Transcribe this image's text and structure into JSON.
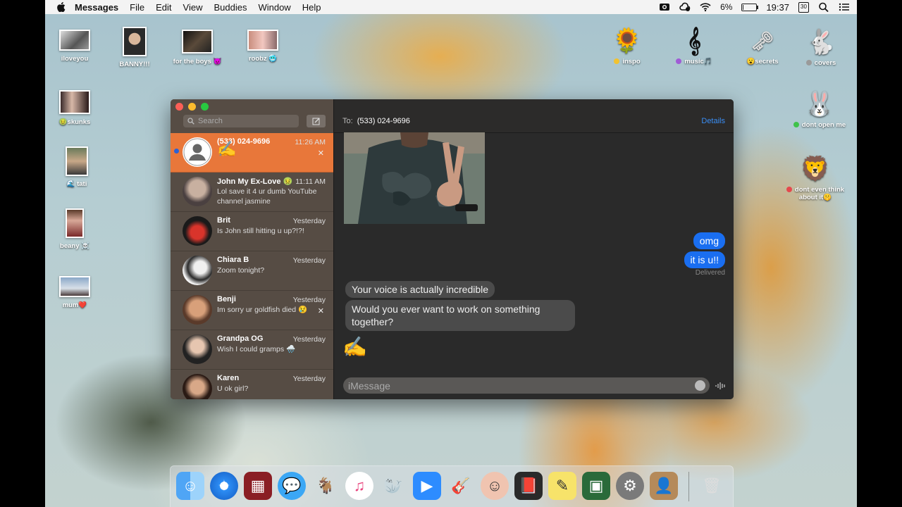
{
  "menubar": {
    "app_name": "Messages",
    "menus": [
      "File",
      "Edit",
      "View",
      "Buddies",
      "Window",
      "Help"
    ],
    "battery": "6%",
    "battery_level": 0.06,
    "clock": "19:37",
    "notif_count": "30"
  },
  "desktop": {
    "left_icons": [
      {
        "label": "iloveyou"
      },
      {
        "label": "BANNY!!!"
      },
      {
        "label": "for the boys 😈"
      },
      {
        "label": "roobz 🥶"
      },
      {
        "label": "skunks",
        "emoji": "🤢"
      },
      {
        "label": "tati",
        "emoji": "🌊"
      },
      {
        "label": "beany ☠️"
      },
      {
        "label": "mum❤️"
      }
    ],
    "right_icons": [
      {
        "label": "inspo",
        "dot_color": "#f2c230"
      },
      {
        "label": "music🎵",
        "dot_color": "#a05cd6"
      },
      {
        "label": "secrets",
        "emoji": "😮"
      },
      {
        "label": "covers",
        "dot_color": "#9a9a9a"
      },
      {
        "label": "dont open me",
        "dot_color": "#3fc24a"
      },
      {
        "label": "dont even think about it🤫",
        "dot_color": "#e5484d"
      }
    ]
  },
  "sidebar": {
    "search_placeholder": "Search",
    "conversations": [
      {
        "name": "(533) 024-9696",
        "time": "11:26 AM",
        "preview": "✍️",
        "active": true
      },
      {
        "name": "John My Ex-Love 🤢 ...",
        "time": "11:11 AM",
        "preview": "Lol save it 4 ur dumb YouTube channel jasmine"
      },
      {
        "name": "Brit",
        "time": "Yesterday",
        "preview": "Is John still hitting u up?!?!"
      },
      {
        "name": "Chiara B",
        "time": "Yesterday",
        "preview": "Zoom tonight?"
      },
      {
        "name": "Benji",
        "time": "Yesterday",
        "preview": "Im sorry ur goldfish died 😢"
      },
      {
        "name": "Grandpa OG",
        "time": "Yesterday",
        "preview": "Wish I could gramps 🌧️"
      },
      {
        "name": "Karen",
        "time": "Yesterday",
        "preview": "U ok girl?"
      }
    ]
  },
  "chat": {
    "to_label": "To:",
    "recipient": "(533) 024-9696",
    "details": "Details",
    "messages": [
      {
        "text": "omg",
        "from": "me"
      },
      {
        "text": "it is u!!",
        "from": "me"
      },
      {
        "text": "Your voice is actually incredible",
        "from": "them"
      },
      {
        "text": "Would you ever want to work on something together?",
        "from": "them"
      }
    ],
    "status": "Delivered",
    "emoji_message": "✍️",
    "input_placeholder": "iMessage"
  },
  "dock": {
    "apps": [
      "finder-icon",
      "safari-icon",
      "photo-booth-icon",
      "messages-icon",
      "mascot-icon",
      "itunes-icon",
      "walrus-icon",
      "zoom-icon",
      "garageband-icon",
      "face-icon",
      "photo-icon",
      "stickies-icon",
      "preview-icon",
      "system-preferences-icon",
      "contacts-icon",
      "trash-icon"
    ]
  }
}
